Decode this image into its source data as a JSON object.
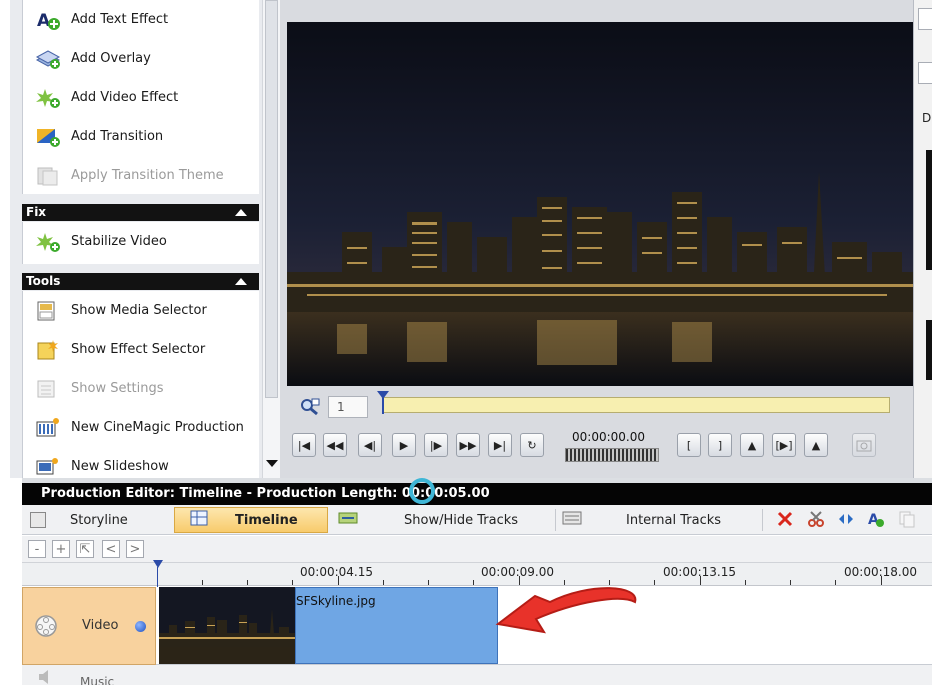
{
  "left_panel": {
    "effects_tasks": [
      {
        "label": "Add Text Effect",
        "icon": "text-effect-icon",
        "enabled": true
      },
      {
        "label": "Add Overlay",
        "icon": "overlay-icon",
        "enabled": true
      },
      {
        "label": "Add Video Effect",
        "icon": "video-effect-icon",
        "enabled": true
      },
      {
        "label": "Add Transition",
        "icon": "transition-icon",
        "enabled": true
      },
      {
        "label": "Apply Transition Theme",
        "icon": "transition-theme-icon",
        "enabled": false
      }
    ],
    "fix_header": "Fix",
    "fix_tasks": [
      {
        "label": "Stabilize Video",
        "icon": "stabilize-icon",
        "enabled": true
      }
    ],
    "tools_header": "Tools",
    "tools_tasks": [
      {
        "label": "Show Media Selector",
        "icon": "media-selector-icon",
        "enabled": true
      },
      {
        "label": "Show Effect Selector",
        "icon": "effect-selector-icon",
        "enabled": true
      },
      {
        "label": "Show Settings",
        "icon": "settings-icon",
        "enabled": false
      },
      {
        "label": "New CineMagic Production",
        "icon": "cinemagic-icon",
        "enabled": true
      },
      {
        "label": "New Slideshow",
        "icon": "slideshow-icon",
        "enabled": true
      }
    ]
  },
  "preview": {
    "page_number": "1",
    "timecode": "00:00:00.00",
    "transport_buttons": [
      "|◀",
      "◀◀",
      "◀|",
      "▶",
      "|▶",
      "▶▶",
      "▶|",
      "↻"
    ],
    "mark_buttons": [
      "[",
      "]",
      "▲",
      "[▶]",
      "▲"
    ],
    "right_panel_label": "Di"
  },
  "timeline": {
    "title": "Production Editor: Timeline - Production Length: 00:00:05.00",
    "tabs": [
      {
        "label": "Storyline",
        "active": false
      },
      {
        "label": "Timeline",
        "active": true
      },
      {
        "label": "Show/Hide Tracks",
        "active": false
      },
      {
        "label": "Internal Tracks",
        "active": false
      }
    ],
    "sub_buttons": [
      "-",
      "+",
      "⇱",
      "<",
      ">"
    ],
    "ruler_labels": [
      "00:00:04.15",
      "00:00:09.00",
      "00:00:13.15",
      "00:00:18.00"
    ],
    "video_track_label": "Video",
    "music_track_label": "Music",
    "clip_name": "SFSkyline.jpg"
  },
  "colors": {
    "accent_orange": "#f8cb6c",
    "clip_blue": "#6fa6e4",
    "scrub_yellow": "#f7efb0",
    "arrow_red": "#e8322a"
  }
}
